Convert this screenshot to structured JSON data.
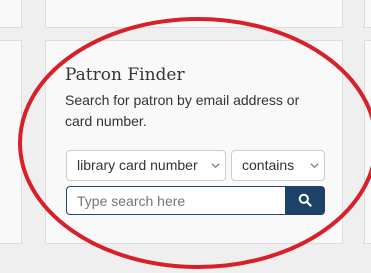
{
  "patron_finder": {
    "title": "Patron Finder",
    "description": "Search for patron by email address or card number.",
    "search_field": {
      "selected": "library card number"
    },
    "match_operator": {
      "selected": "contains"
    },
    "search_input": {
      "value": "",
      "placeholder": "Type search here"
    },
    "search_button": {
      "icon": "search-icon"
    }
  },
  "colors": {
    "accent": "#1d4267",
    "annotation": "#d8202a",
    "card_background": "#f9f9f9",
    "page_background": "#efefef"
  }
}
